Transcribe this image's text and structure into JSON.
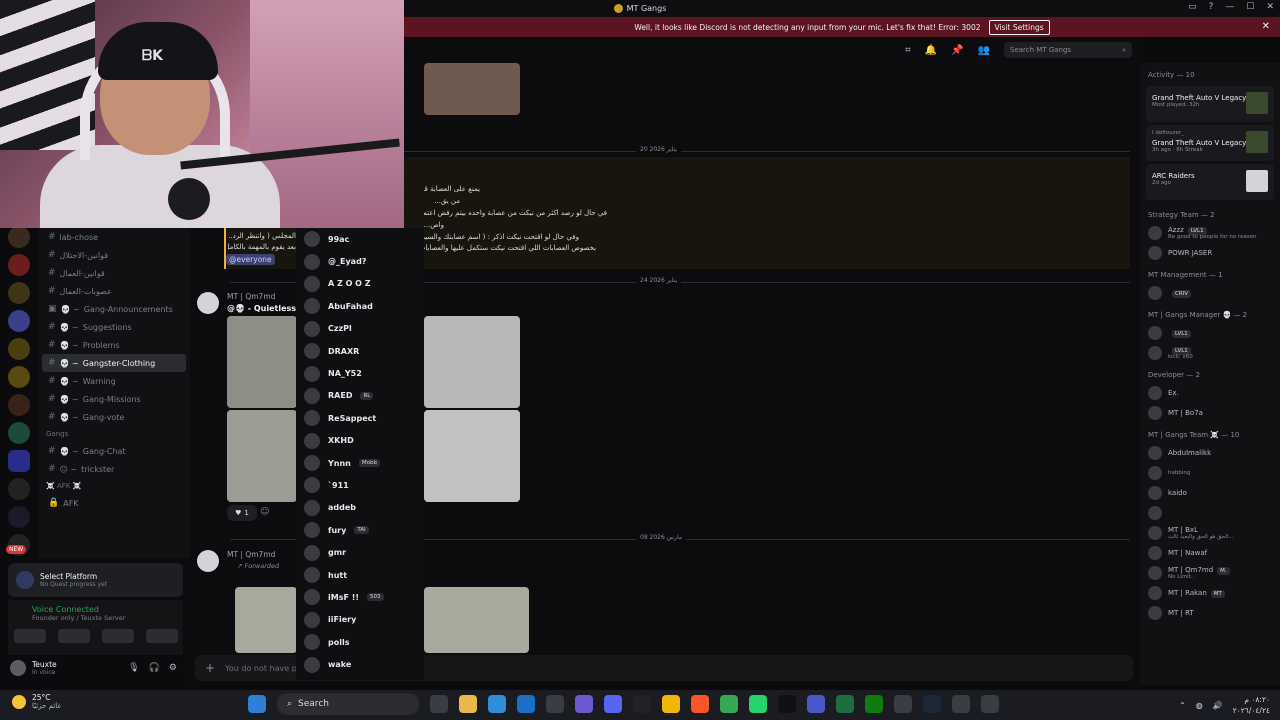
{
  "window": {
    "title": "MT Gangs"
  },
  "notice": {
    "message": "Well, it looks like Discord is not detecting any input from your mic. Let's fix that!  Error: 3002",
    "button": "Visit Settings"
  },
  "channels": [
    {
      "label": "lab-chose",
      "prefix": ""
    },
    {
      "label": "قوانين-الاحتلال",
      "prefix": ""
    },
    {
      "label": "قوانين-العمال",
      "prefix": ""
    },
    {
      "label": "عصوبات-العمال",
      "prefix": ""
    },
    {
      "label": "Gang-Announcements",
      "prefix": "💀 ~"
    },
    {
      "label": "Suggestions",
      "prefix": "💀 ~"
    },
    {
      "label": "Problems",
      "prefix": "💀 ~"
    },
    {
      "label": "Gangster-Clothing",
      "prefix": "💀 ~",
      "active": true
    },
    {
      "label": "Warning",
      "prefix": "💀 ~"
    },
    {
      "label": "Gang-Missions",
      "prefix": "💀 ~"
    },
    {
      "label": "Gang-vote",
      "prefix": "💀 ~"
    }
  ],
  "gangs_category": "Gangs",
  "gangs_channels": [
    {
      "label": "Gang-Chat",
      "prefix": "💀 ~"
    },
    {
      "label": "trickster",
      "prefix": "😐 ~"
    }
  ],
  "afk_category": "☠️ AFK ☠️",
  "afk_channel": "AFK",
  "new_badge": "NEW",
  "platform": {
    "title": "Select Platform",
    "subtitle": "No Quest progress yet"
  },
  "voice": {
    "status": "Voice Connected",
    "server": "Founder only / Teuxte Server"
  },
  "user": {
    "name": "Teuxte",
    "status": "In voice"
  },
  "popup_members": [
    {
      "name": "99ac"
    },
    {
      "name": "@_Eyad?"
    },
    {
      "name": "A Z O O Z"
    },
    {
      "name": "AbuFahad"
    },
    {
      "name": "CzzPl"
    },
    {
      "name": "DRAXR"
    },
    {
      "name": "NA_Y52"
    },
    {
      "name": "RAED",
      "tag": "RL"
    },
    {
      "name": "ReSappect"
    },
    {
      "name": "XKHD"
    },
    {
      "name": "Ynnn",
      "tag": "Mobb"
    },
    {
      "name": "`911"
    },
    {
      "name": "addeb"
    },
    {
      "name": "fury",
      "tag": "TAI"
    },
    {
      "name": "gmr"
    },
    {
      "name": "hutt"
    },
    {
      "name": "iMsF !!",
      "tag": "503"
    },
    {
      "name": "iiFiery"
    },
    {
      "name": "polls"
    },
    {
      "name": "wake"
    }
  ],
  "chat": {
    "search_placeholder": "Search MT Gangs",
    "date1": "20 يناير 2026",
    "date2": "24 يناير 2026",
    "date3": "08 مارس 2026",
    "arabic_lines": [
      "يمنع على العصابة قت...",
      "من يق...",
      "في حال لو رصد اكثر من نيكت من عصابة واحده بيتم رفض اعتماد ا...",
      "واص...",
      "وفي حال لو اقتحت نيكت اذكر : ( اسم عصابتك والسيرفر ا...",
      "بخصوص العصابات اللي اقتحت نيكت ستكمل عليها والعصابات ا..."
    ],
    "left_arabic": [
      "المجلس ( وانتظر الرد...",
      "بعد يقوم بالمهمة بالكامل..."
    ],
    "mention": "@everyone",
    "msg1_author": "MT | Qm7md",
    "msg1_text": "@💀 - Quietless",
    "reaction_count": "1",
    "msg2_author": "MT | Qm7md",
    "forwarded": "Forwarded",
    "composer_placeholder": "You do not have pe...                                                                    ...hannel."
  },
  "activity": {
    "title": "Activity — 10",
    "cards": [
      {
        "game": "Grand Theft Auto V Legacy",
        "meta": "Most played: 32h",
        "user": ""
      },
      {
        "game": "Grand Theft Auto V Legacy",
        "meta": "3h ago  ·  8h Streak",
        "user": "I defiouzer_"
      },
      {
        "game": "ARC Raiders",
        "meta": "2d ago",
        "user": ""
      }
    ]
  },
  "member_sections": [
    {
      "title": "Strategy Team — 2",
      "members": [
        {
          "name": "Azzz",
          "tag": "LVL1",
          "sub": "Be good to people for no reason"
        },
        {
          "name": "POWR JASER",
          "tag": "",
          "sub": ""
        }
      ]
    },
    {
      "title": "MT Management — 1",
      "members": [
        {
          "name": "",
          "tag": "CRIV",
          "sub": ""
        }
      ]
    },
    {
      "title": "MT | Gangs Manager 💀 — 2",
      "members": [
        {
          "name": "",
          "tag": "LVL1",
          "sub": ""
        },
        {
          "name": "",
          "tag": "LVL1",
          "sub": "kick: x60"
        }
      ]
    },
    {
      "title": "Developer — 2",
      "members": [
        {
          "name": "Ex.",
          "tag": "",
          "sub": ""
        },
        {
          "name": "MT | Bo7a",
          "tag": "",
          "sub": ""
        }
      ]
    },
    {
      "title": "MT | Gangs Team ☠️ — 10",
      "members": [
        {
          "name": "Abdulmalikk",
          "tag": "",
          "sub": ""
        },
        {
          "name": "",
          "tag": "",
          "sub": "habbing"
        },
        {
          "name": "kaido",
          "tag": "",
          "sub": ""
        },
        {
          "name": "",
          "tag": "",
          "sub": ""
        },
        {
          "name": "MT | BxL",
          "tag": "",
          "sub": "الحق هو الحق والبعيد ثالث..."
        },
        {
          "name": "MT | Nawaf",
          "tag": "",
          "sub": ""
        },
        {
          "name": "MT | Qm7md",
          "tag": "M.",
          "sub": "No Limit.."
        },
        {
          "name": "MT | Rakan",
          "tag": "MT",
          "sub": ""
        },
        {
          "name": "MT | RT",
          "tag": "",
          "sub": ""
        }
      ]
    }
  ],
  "taskbar": {
    "temp": "25°C",
    "condition": "غائم جزئيًا",
    "search": "Search",
    "time": "٠٨:٢٠ م",
    "date": "٢٠٢٦/٠٤/٢٤"
  }
}
